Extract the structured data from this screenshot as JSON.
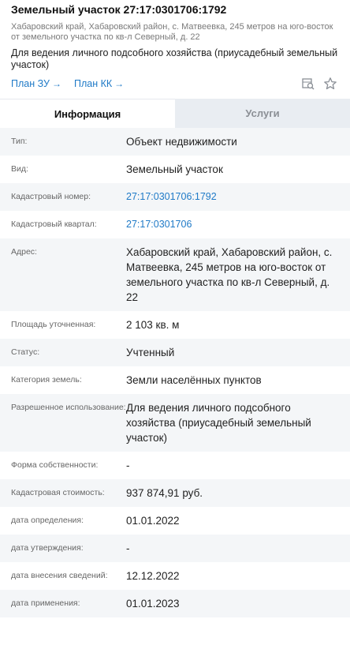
{
  "header": {
    "title": "Земельный участок 27:17:0301706:1792",
    "address": "Хабаровский край, Хабаровский район, с. Матвеевка, 245 метров на юго-восток от земельного участка по кв-л Северный, д. 22",
    "purpose": "Для ведения личного подсобного хозяйства (приусадебный земельный участок)",
    "plan_zu_label": "План ЗУ",
    "plan_kk_label": "План КК",
    "arrow": "→"
  },
  "tabs": [
    {
      "label": "Информация"
    },
    {
      "label": "Услуги"
    }
  ],
  "info_rows": [
    {
      "label": "Тип:",
      "value": "Объект недвижимости"
    },
    {
      "label": "Вид:",
      "value": "Земельный участок"
    },
    {
      "label": "Кадастровый номер:",
      "value": "27:17:0301706:1792"
    },
    {
      "label": "Кадастровый квартал:",
      "value": "27:17:0301706"
    },
    {
      "label": "Адрес:",
      "value": "Хабаровский край, Хабаровский район, с. Матвеевка, 245 метров на юго-восток от земельного участка по кв-л Северный, д. 22"
    },
    {
      "label": "Площадь уточненная:",
      "value": "2 103 кв. м"
    },
    {
      "label": "Статус:",
      "value": "Учтенный"
    },
    {
      "label": "Категория земель:",
      "value": "Земли населённых пунктов"
    },
    {
      "label": "Разрешенное использование:",
      "value": "Для ведения личного подсобного хозяйства (приусадебный земельный участок)"
    },
    {
      "label": "Форма собственности:",
      "value": "-"
    },
    {
      "label": "Кадастровая стоимость:",
      "value": "937 874,91 руб."
    },
    {
      "label": "дата определения:",
      "value": "01.01.2022"
    },
    {
      "label": "дата утверждения:",
      "value": "-"
    },
    {
      "label": "дата внесения сведений:",
      "value": "12.12.2022"
    },
    {
      "label": "дата применения:",
      "value": "01.01.2023"
    }
  ],
  "colors": {
    "link": "#1f7ac7",
    "row_alt_bg": "#f4f6f8",
    "inactive_tab_bg": "#e9edf2"
  },
  "icons": [
    "map-search-icon",
    "star-icon",
    "arrow-right-icon"
  ]
}
